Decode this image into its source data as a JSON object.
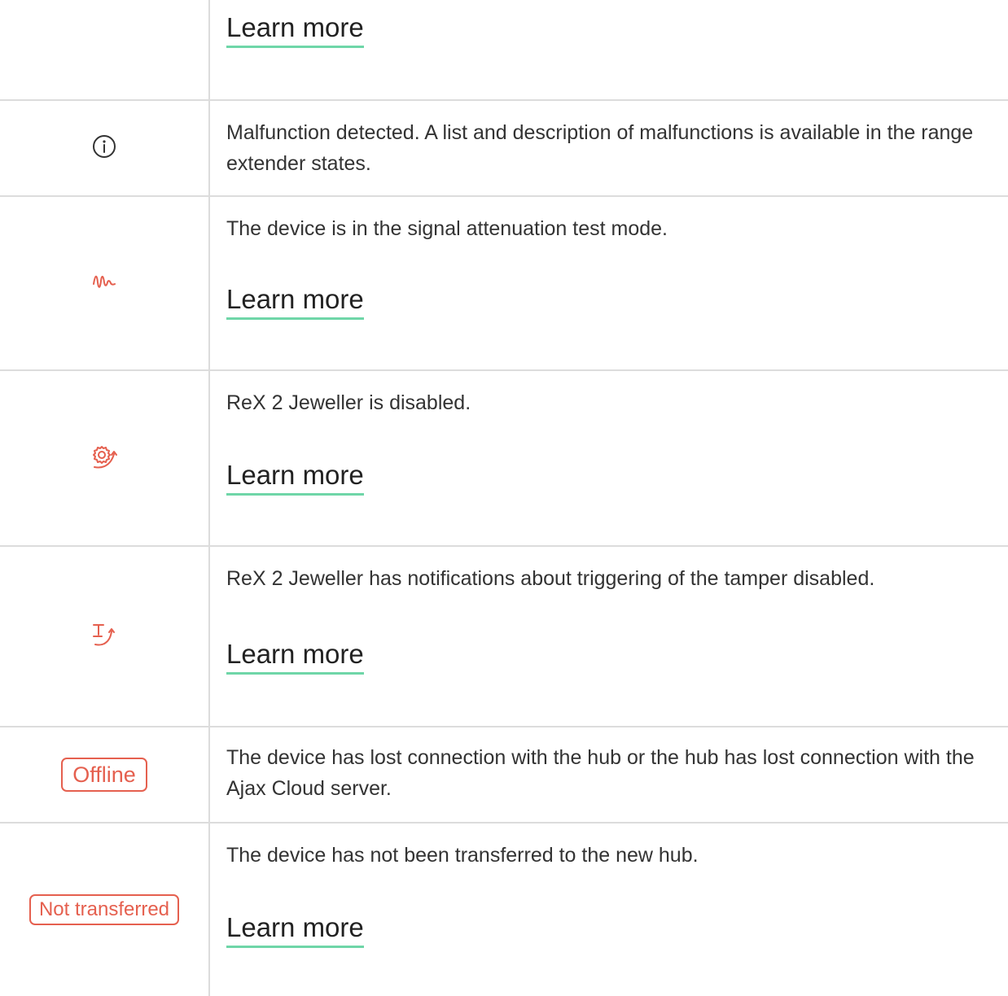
{
  "colors": {
    "accent_red": "#e5604f",
    "link_underline": "#6fd6a8",
    "grid_line": "#dcdcdc",
    "text": "#333333"
  },
  "rows": [
    {
      "icon": "none",
      "learn_more": "Learn more"
    },
    {
      "icon": "info-circle-icon",
      "description": "Malfunction detected. A list and description of malfunctions is available in the range extender states."
    },
    {
      "icon": "signal-wave-icon",
      "description": "The device is in the signal attenuation test mode.",
      "learn_more": "Learn more"
    },
    {
      "icon": "gear-disabled-icon",
      "description": "ReX 2 Jeweller is disabled.",
      "learn_more": "Learn more"
    },
    {
      "icon": "tamper-disabled-icon",
      "description": "ReX 2 Jeweller has notifications about triggering of the tamper disabled.",
      "learn_more": "Learn more"
    },
    {
      "badge": "Offline",
      "description": "The device has lost connection with the hub or the hub has lost connection with the Ajax Cloud server."
    },
    {
      "badge": "Not transferred",
      "description": "The device has not been transferred to the new hub.",
      "learn_more": "Learn more"
    }
  ]
}
